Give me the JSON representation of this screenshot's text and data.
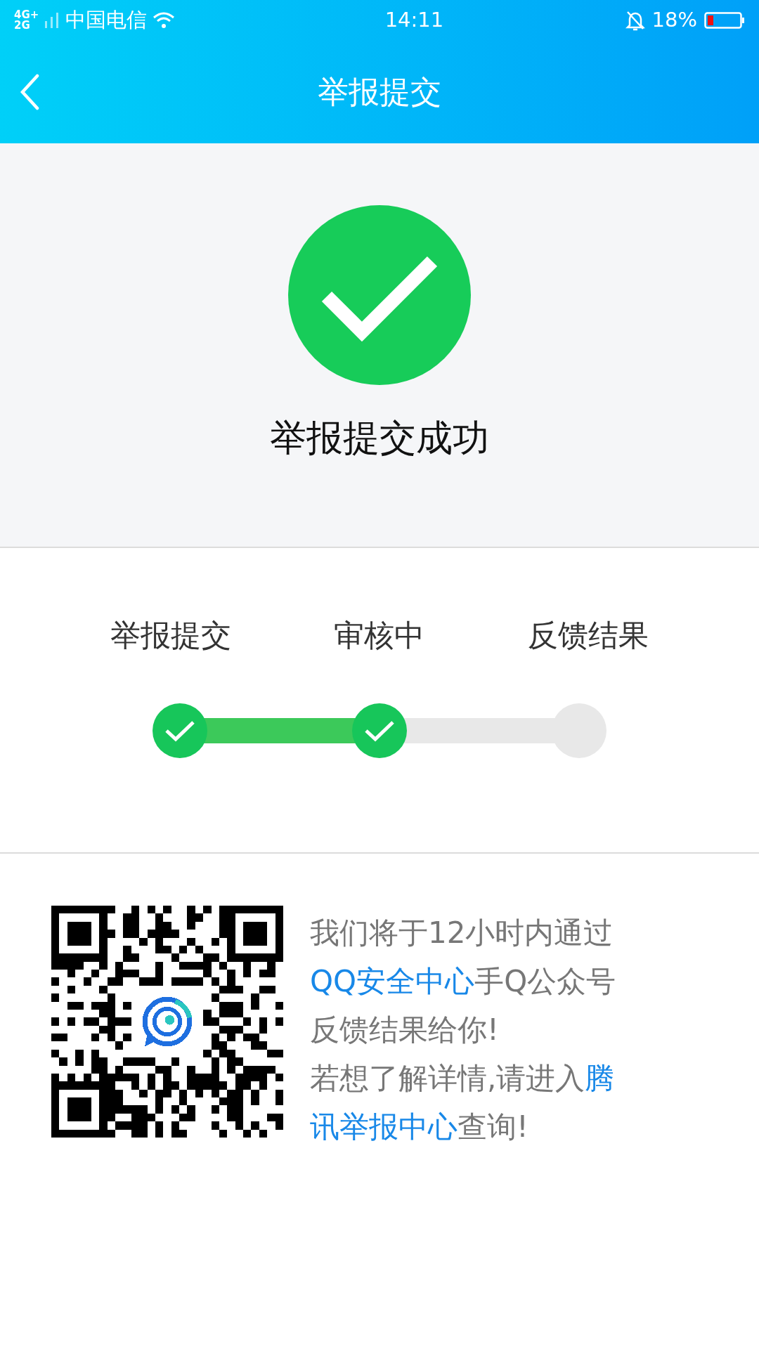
{
  "status_bar": {
    "network_top": "4G+",
    "network_bottom": "2G",
    "carrier": "中国电信",
    "time": "14:11",
    "battery": "18%"
  },
  "header": {
    "title": "举报提交"
  },
  "result": {
    "title": "举报提交成功",
    "success": true
  },
  "steps": [
    {
      "label": "举报提交",
      "done": true
    },
    {
      "label": "审核中",
      "done": true
    },
    {
      "label": "反馈结果",
      "done": false
    }
  ],
  "message_lines": [
    [
      {
        "kind": "plain",
        "text": "我们将于12小时内通过"
      }
    ],
    [
      {
        "kind": "link",
        "text": "QQ安全中心"
      },
      {
        "kind": "plain",
        "text": "手Q公众号"
      }
    ],
    [
      {
        "kind": "plain",
        "text": "反馈结果给你!"
      }
    ],
    [
      {
        "kind": "plain",
        "text": "若想了解详情,请进入"
      },
      {
        "kind": "link",
        "text": "腾"
      }
    ],
    [
      {
        "kind": "link",
        "text": "讯举报中心"
      },
      {
        "kind": "plain",
        "text": "查询!"
      }
    ]
  ]
}
